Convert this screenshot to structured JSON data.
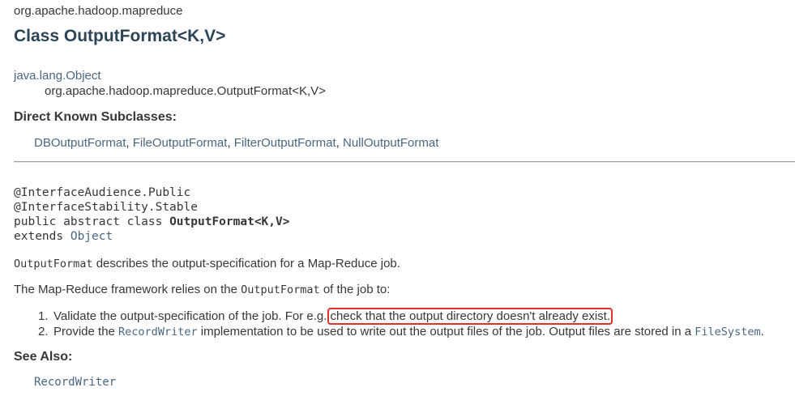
{
  "header": {
    "package_name": "org.apache.hadoop.mapreduce",
    "class_title": "Class OutputFormat<K,V>"
  },
  "inheritance": {
    "root": "java.lang.Object",
    "child": "org.apache.hadoop.mapreduce.OutputFormat<K,V>"
  },
  "subclasses": {
    "heading": "Direct Known Subclasses:",
    "items": [
      "DBOutputFormat",
      "FileOutputFormat",
      "FilterOutputFormat",
      "NullOutputFormat"
    ],
    "separator": ", "
  },
  "signature": {
    "annotation1": "@InterfaceAudience.Public",
    "annotation2": "@InterfaceStability.Stable",
    "decl_prefix": "public abstract class ",
    "decl_name": "OutputFormat<K,V>",
    "extends_keyword": "extends ",
    "extends_type": "Object"
  },
  "description": {
    "p1_code": "OutputFormat",
    "p1_text": " describes the output-specification for a Map-Reduce job.",
    "p2_text": "The Map-Reduce framework relies on the ",
    "p2_code": "OutputFormat",
    "p2_suffix": " of the job to:",
    "item1_num": "1.",
    "item1_text": "Validate the output-specification of the job. For e.g.",
    "item1_highlight": "check that the output directory doesn't already exist.",
    "item2_num": "2.",
    "item2_prefix": "Provide the ",
    "item2_code": "RecordWriter",
    "item2_mid": " implementation to be used to write out the output files of the job. Output files are stored in a ",
    "item2_code2": "FileSystem",
    "item2_end": "."
  },
  "see_also": {
    "heading": "See Also:",
    "link": "RecordWriter"
  },
  "colors": {
    "title": "#2c4557",
    "link": "#4a6782",
    "text": "#353833",
    "highlight_border": "#e0312a"
  }
}
